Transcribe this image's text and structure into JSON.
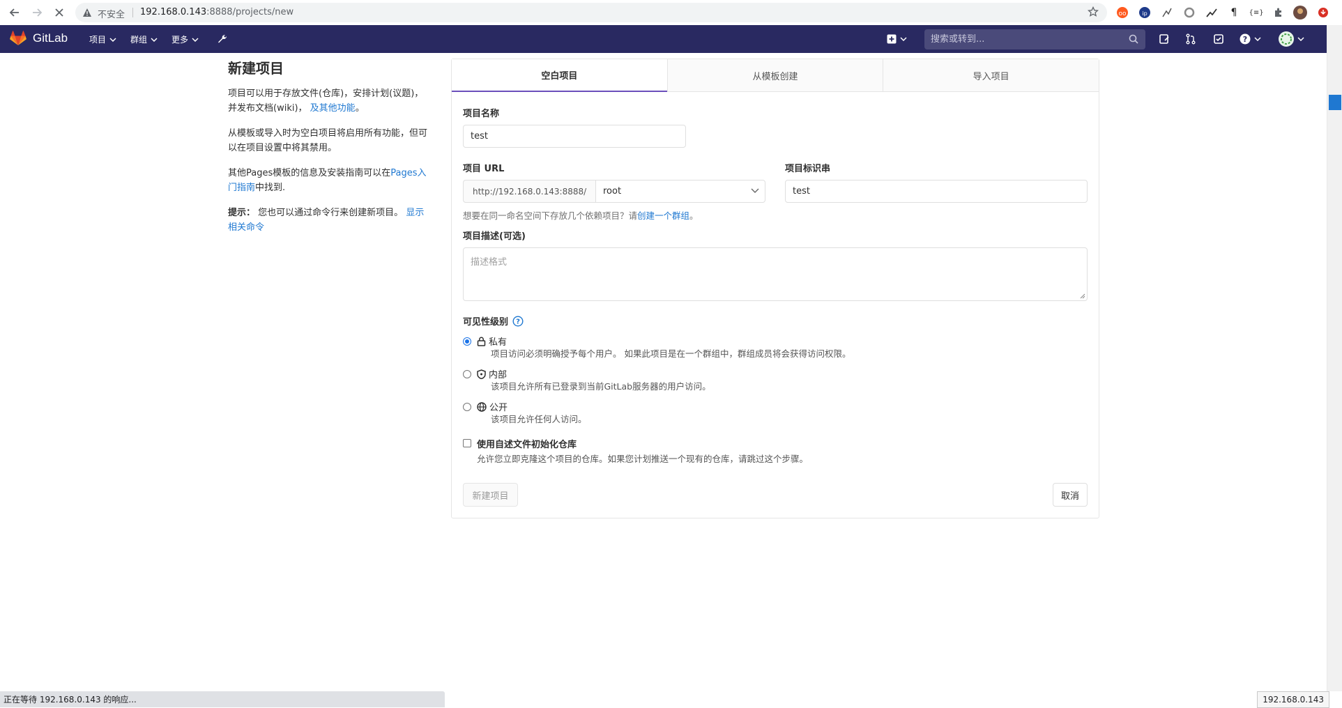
{
  "browser": {
    "insecure_label": "不安全",
    "url_host": "192.168.0.143",
    "url_rest": ":8888/projects/new",
    "status_loading": "正在等待 192.168.0.143 的响应...",
    "status_hover": "192.168.0.143"
  },
  "header": {
    "brand": "GitLab",
    "menu": {
      "projects": "项目",
      "groups": "群组",
      "more": "更多"
    },
    "search_placeholder": "搜索或转到..."
  },
  "intro": {
    "title": "新建项目",
    "p1": "项目可以用于存放文件(仓库)，安排计划(议题)，并发布文档(wiki)，",
    "p1_link": "及其他功能",
    "p1_end": "。",
    "p2": "从模板或导入时为空白项目将启用所有功能，但可以在项目设置中将其禁用。",
    "p3_pre": "其他Pages模板的信息及安装指南可以在",
    "p3_link": "Pages入门指南",
    "p3_post": "中找到.",
    "tip_label": "提示：",
    "tip_text": "您也可以通过命令行来创建新项目。",
    "tip_link": "显示相关命令"
  },
  "tabs": [
    "空白项目",
    "从模板创建",
    "导入项目"
  ],
  "form": {
    "name_label": "项目名称",
    "name_value": "test",
    "url_label": "项目 URL",
    "url_prefix": "http://192.168.0.143:8888/",
    "namespace": "root",
    "slug_label": "项目标识串",
    "slug_value": "test",
    "group_help_pre": "想要在同一命名空间下存放几个依赖项目？请",
    "group_help_link": "创建一个群组",
    "group_help_end": "。",
    "desc_label": "项目描述(可选)",
    "desc_placeholder": "描述格式",
    "visibility_label": "可见性级别",
    "visibility": [
      {
        "title": "私有",
        "desc": "项目访问必须明确授予每个用户。 如果此项目是在一个群组中，群组成员将会获得访问权限。",
        "icon": "lock-icon",
        "checked": true
      },
      {
        "title": "内部",
        "desc": "该项目允许所有已登录到当前GitLab服务器的用户访问。",
        "icon": "shield-icon",
        "checked": false
      },
      {
        "title": "公开",
        "desc": "该项目允许任何人访问。",
        "icon": "globe-icon",
        "checked": false
      }
    ],
    "readme_label": "使用自述文件初始化仓库",
    "readme_desc": "允许您立即克隆这个项目的仓库。如果您计划推送一个现有的仓库，请跳过这个步骤。",
    "create_button": "新建项目",
    "cancel_button": "取消"
  },
  "colors": {
    "header_bg": "#292961",
    "accent_tab": "#6b4fbb",
    "link": "#1f78d1"
  }
}
